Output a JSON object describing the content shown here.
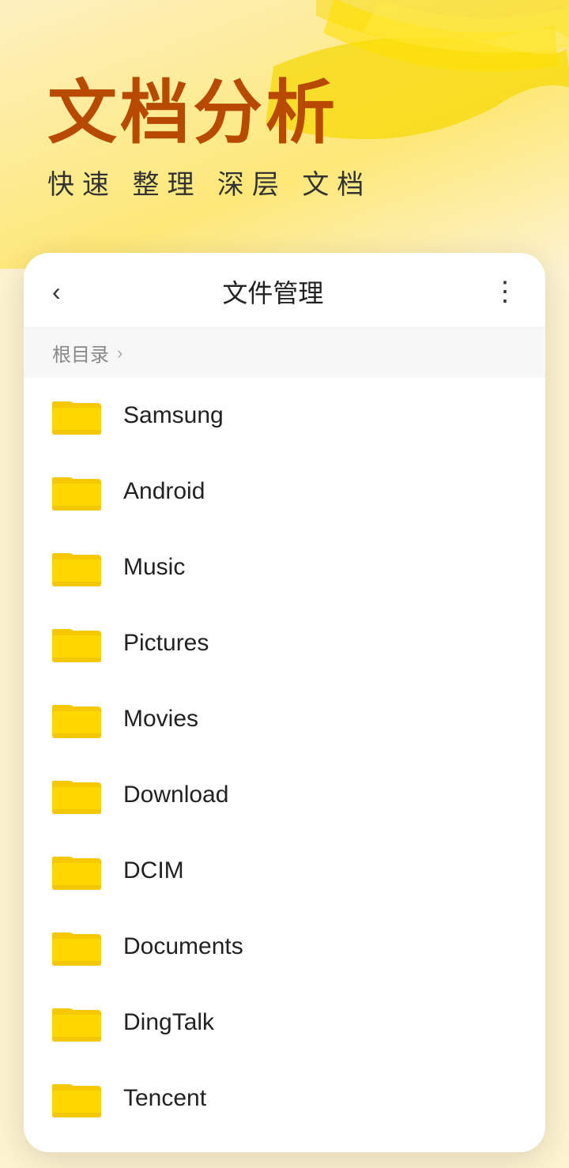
{
  "banner": {
    "title": "文档分析",
    "subtitle": "快速 整理 深层 文档",
    "accent_color": "#b84a00",
    "bg_color": "#fdf3d0"
  },
  "file_manager": {
    "header": {
      "back_label": "‹",
      "title": "文件管理",
      "more_label": "⋮"
    },
    "breadcrumb": {
      "root_label": "根目录",
      "arrow": "›"
    },
    "folders": [
      {
        "name": "Samsung"
      },
      {
        "name": "Android"
      },
      {
        "name": "Music"
      },
      {
        "name": "Pictures"
      },
      {
        "name": "Movies"
      },
      {
        "name": "Download"
      },
      {
        "name": "DCIM"
      },
      {
        "name": "Documents"
      },
      {
        "name": "DingTalk"
      },
      {
        "name": "Tencent"
      }
    ]
  }
}
